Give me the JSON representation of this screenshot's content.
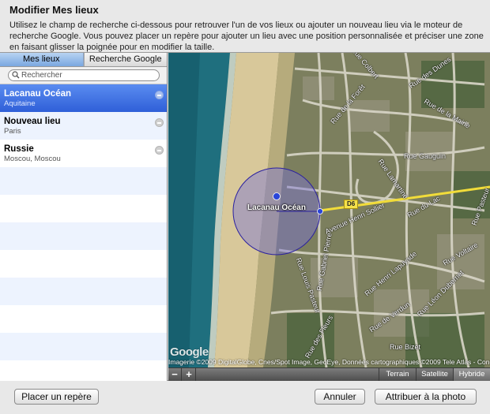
{
  "dialog": {
    "title": "Modifier Mes lieux",
    "description": "Utilisez le champ de recherche ci-dessous pour retrouver l'un de vos lieux ou ajouter un nouveau lieu via le moteur de recherche Google. Vous pouvez placer un repère pour ajouter un lieu avec une position personnalisée et préciser une zone en faisant glisser la poignée pour en modifier la taille."
  },
  "tabs": [
    {
      "label": "Mes lieux",
      "active": true
    },
    {
      "label": "Recherche Google",
      "active": false
    }
  ],
  "search": {
    "placeholder": "Rechercher",
    "value": ""
  },
  "places": [
    {
      "name": "Lacanau Océan",
      "region": "Aquitaine",
      "selected": true
    },
    {
      "name": "Nouveau lieu",
      "region": "Paris",
      "selected": false
    },
    {
      "name": "Russie",
      "region": "Moscou, Moscou",
      "selected": false
    }
  ],
  "map": {
    "city_label": "Lacanau Océan",
    "road_badge": "D6",
    "google_logo": "Google",
    "copyright": "Imagerie ©2009 DigitalGlobe, Cnes/Spot Image, GeoEye, Données cartographiques ©2009 Tele Atlas - Conditions d'utilisation",
    "zoom_out": "−",
    "zoom_in": "+",
    "map_types": [
      {
        "label": "Terrain",
        "active": false
      },
      {
        "label": "Satellite",
        "active": false
      },
      {
        "label": "Hybride",
        "active": true
      }
    ],
    "street_labels": [
      "Rue Colbert",
      "Rue des Dunes",
      "Rue de la Forêt",
      "Rue Gauguin",
      "Rue Lamartine",
      "Avenue Henri Sollier",
      "Rue Henri Lapuyade",
      "Rue de Verdun",
      "Rue Léon Dubernet",
      "Rue Voltaire",
      "Rue Pasteur",
      "Rue Gabriel Pierre",
      "Rue Louis Pasteur",
      "Rue Bizet",
      "Rue des Fleurs",
      "Rue du Lac",
      "Rue de la Mairie"
    ]
  },
  "buttons": {
    "place_marker": "Placer un repère",
    "cancel": "Annuler",
    "assign": "Attribuer à la photo"
  }
}
